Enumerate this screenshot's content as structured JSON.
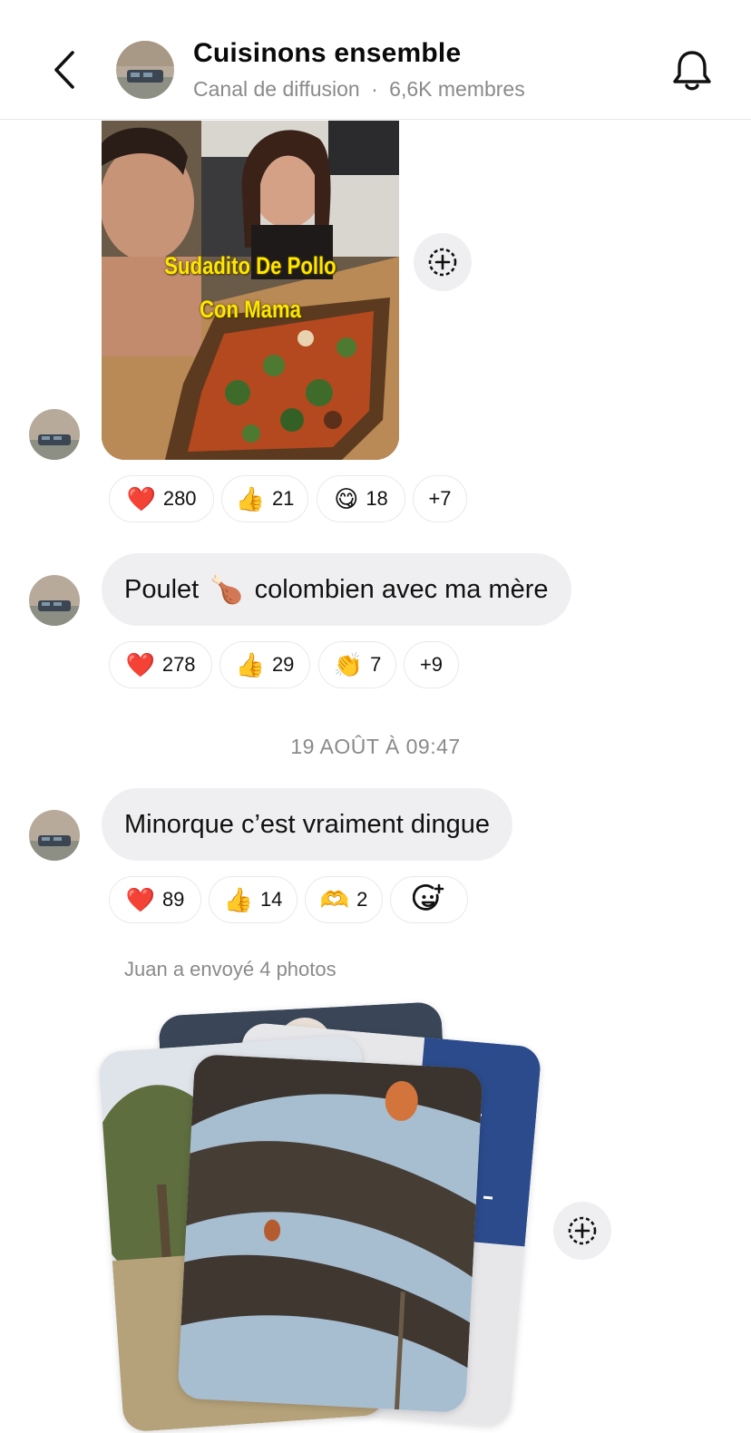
{
  "header": {
    "title": "Cuisinons ensemble",
    "subtitle_type": "Canal de diffusion",
    "subtitle_sep": "·",
    "subtitle_members": "6,6K membres"
  },
  "video_message": {
    "overlay_line1": "Sudadito De Pollo",
    "overlay_line2": "Con Mama",
    "reactions": [
      {
        "emoji": "❤️",
        "count": "280"
      },
      {
        "emoji": "👍",
        "count": "21"
      },
      {
        "emoji": "😋",
        "count": "18"
      },
      {
        "emoji": "",
        "count": "+7"
      }
    ]
  },
  "message1": {
    "text_before": "Poulet",
    "emoji": "🍗",
    "text_after": "colombien avec ma mère",
    "reactions": [
      {
        "emoji": "❤️",
        "count": "278"
      },
      {
        "emoji": "👍",
        "count": "29"
      },
      {
        "emoji": "👏",
        "count": "7"
      },
      {
        "emoji": "",
        "count": "+9"
      }
    ]
  },
  "timestamp": "19 AOÛT À 09:47",
  "message2": {
    "text": "Minorque c’est vraiment dingue",
    "reactions": [
      {
        "emoji": "❤️",
        "count": "89"
      },
      {
        "emoji": "👍",
        "count": "14"
      },
      {
        "emoji": "🫶",
        "count": "2"
      }
    ]
  },
  "photos_note": "Juan a envoyé 4 photos",
  "icons": {
    "back": "chevron-left-icon",
    "bell": "bell-icon",
    "share": "add-circle-icon",
    "add_reaction": "add-reaction-icon"
  }
}
